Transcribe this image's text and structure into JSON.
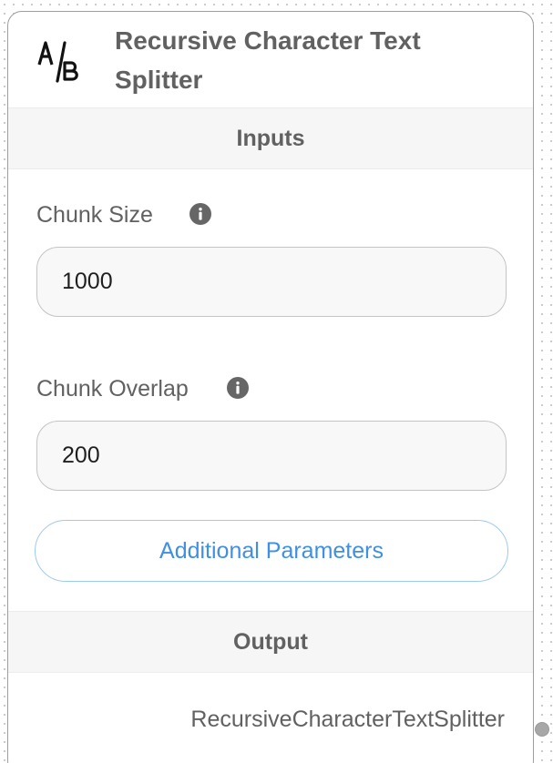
{
  "node": {
    "title": "Recursive Character Text Splitter",
    "logo_icon": "a-b-splitter-icon"
  },
  "inputs_section": {
    "heading": "Inputs",
    "fields": [
      {
        "label": "Chunk Size",
        "value": "1000",
        "info_icon": "info-icon"
      },
      {
        "label": "Chunk Overlap",
        "value": "200",
        "info_icon": "info-icon"
      }
    ],
    "additional_parameters_label": "Additional Parameters"
  },
  "output_section": {
    "heading": "Output",
    "output_name": "RecursiveCharacterTextSplitter"
  },
  "colors": {
    "title_text": "#616161",
    "accent_blue": "#3f8fe3",
    "button_border": "#9ec9ef",
    "section_bg": "#f6f6f6",
    "card_border": "#9e9e9e"
  }
}
